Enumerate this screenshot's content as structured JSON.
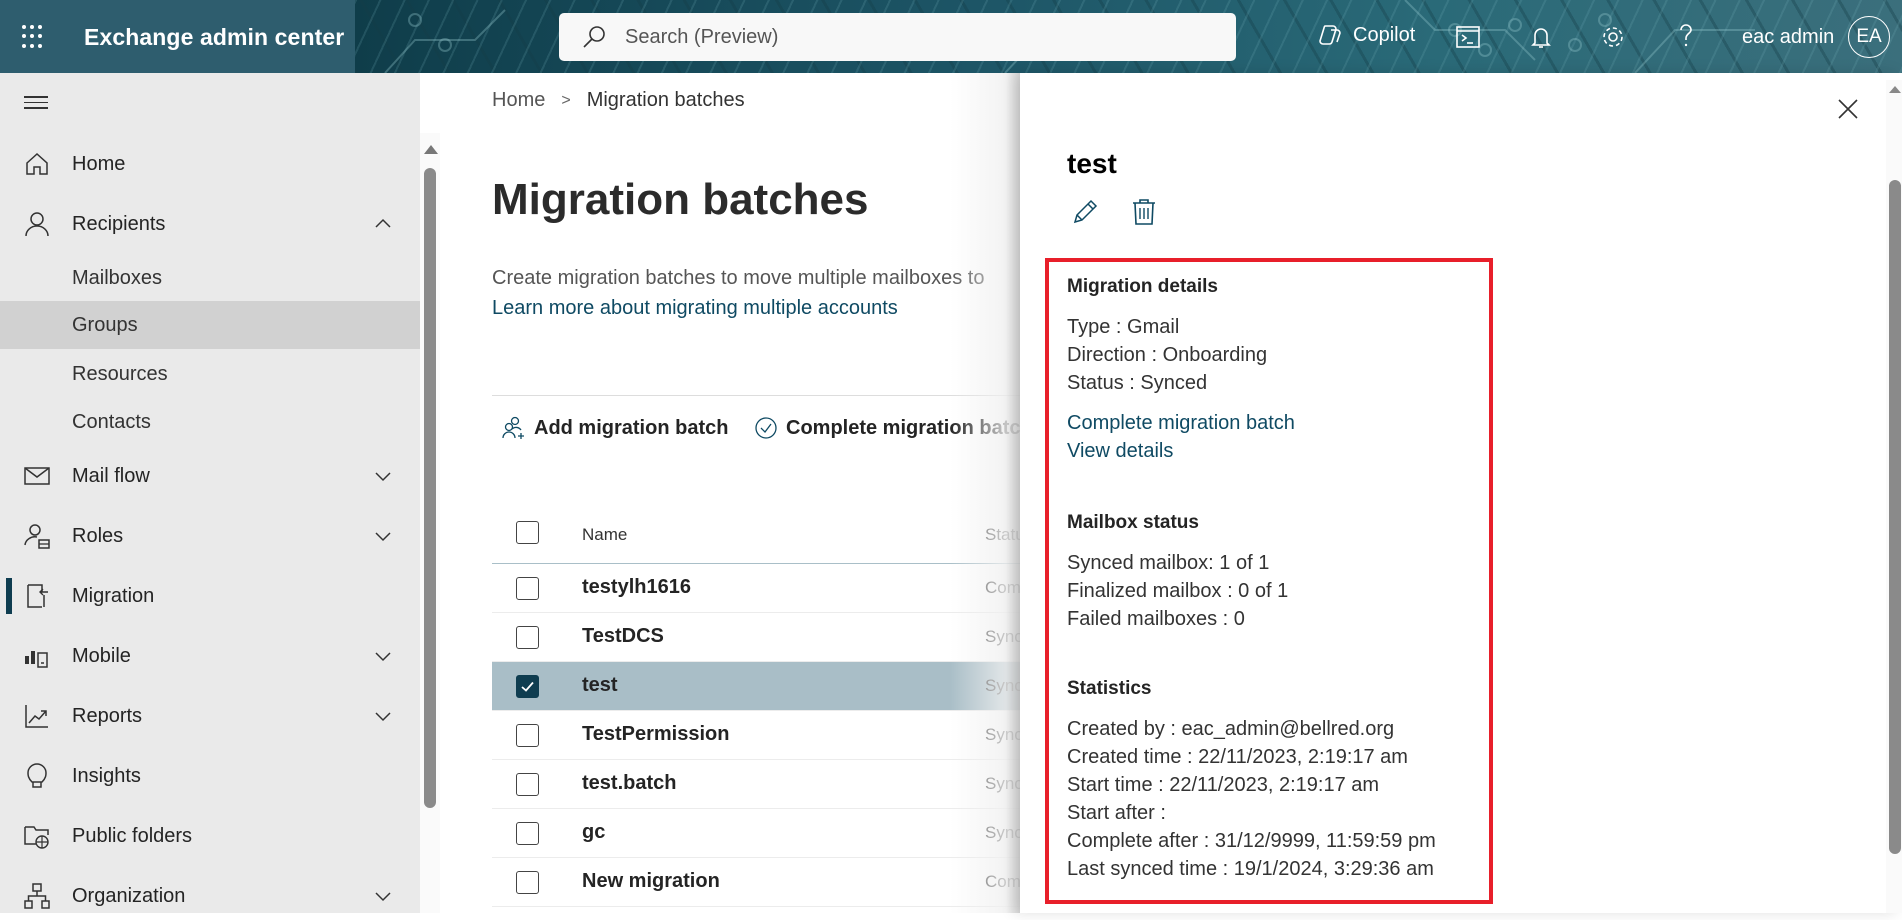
{
  "header": {
    "app_title": "Exchange admin center",
    "search_placeholder": "Search (Preview)",
    "copilot_label": "Copilot",
    "user_name": "eac admin",
    "avatar_initials": "EA",
    "icons": [
      "app-launcher-icon",
      "search-icon",
      "copilot-icon",
      "terminal-icon",
      "bell-icon",
      "gear-icon",
      "help-icon"
    ]
  },
  "sidebar": {
    "items": [
      {
        "label": "Home",
        "icon": "home-icon"
      },
      {
        "label": "Recipients",
        "icon": "person-icon",
        "expanded": true
      },
      {
        "label": "Mailboxes"
      },
      {
        "label": "Groups",
        "active": true
      },
      {
        "label": "Resources"
      },
      {
        "label": "Contacts"
      },
      {
        "label": "Mail flow",
        "icon": "mail-icon",
        "expanded": false
      },
      {
        "label": "Roles",
        "icon": "roles-icon",
        "expanded": false
      },
      {
        "label": "Migration",
        "icon": "migration-icon",
        "current": true
      },
      {
        "label": "Mobile",
        "icon": "mobile-icon",
        "expanded": false
      },
      {
        "label": "Reports",
        "icon": "reports-icon",
        "expanded": false
      },
      {
        "label": "Insights",
        "icon": "lightbulb-icon"
      },
      {
        "label": "Public folders",
        "icon": "public-folder-icon"
      },
      {
        "label": "Organization",
        "icon": "organization-icon",
        "expanded": false
      }
    ]
  },
  "main": {
    "breadcrumb": {
      "home": "Home",
      "separator": ">",
      "current": "Migration batches"
    },
    "title": "Migration batches",
    "description": "Create migration batches to move multiple mailboxes to",
    "learn_more": "Learn more about migrating multiple accounts",
    "commands": {
      "add": "Add migration batch",
      "complete": "Complete migration batc"
    },
    "table": {
      "columns": [
        "Name",
        "Statu"
      ],
      "rows": [
        {
          "name": "testylh1616",
          "status": "Com",
          "selected": false
        },
        {
          "name": "TestDCS",
          "status": "Sync",
          "selected": false
        },
        {
          "name": "test",
          "status": "Sync",
          "selected": true
        },
        {
          "name": "TestPermission",
          "status": "Sync",
          "selected": false
        },
        {
          "name": "test.batch",
          "status": "Sync",
          "selected": false
        },
        {
          "name": "gc",
          "status": "Sync",
          "selected": false
        },
        {
          "name": "New migration",
          "status": "Com",
          "selected": false
        }
      ]
    }
  },
  "panel": {
    "title": "test",
    "migration_details": {
      "heading": "Migration details",
      "type": "Type : Gmail",
      "direction": "Direction : Onboarding",
      "status": "Status : Synced",
      "complete_link": "Complete migration batch",
      "view_details_link": "View details"
    },
    "mailbox_status": {
      "heading": "Mailbox status",
      "synced": "Synced mailbox: 1 of 1",
      "finalized": "Finalized mailbox : 0 of 1",
      "failed": "Failed mailboxes : 0"
    },
    "statistics": {
      "heading": "Statistics",
      "created_by": "Created by : eac_admin@bellred.org",
      "created_time": "Created time : 22/11/2023, 2:19:17 am",
      "start_time": "Start time : 22/11/2023, 2:19:17 am",
      "start_after": "Start after :",
      "complete_after": "Complete after : 31/12/9999, 11:59:59 pm",
      "last_synced": "Last synced time : 19/1/2024, 3:29:36 am"
    },
    "highlight_color": "#e81f2a"
  },
  "colors": {
    "brand_dark": "#0f3d50",
    "link": "#0f4a63",
    "selected_row": "#a9bec7",
    "sidebar_bg": "#eaeaea"
  }
}
